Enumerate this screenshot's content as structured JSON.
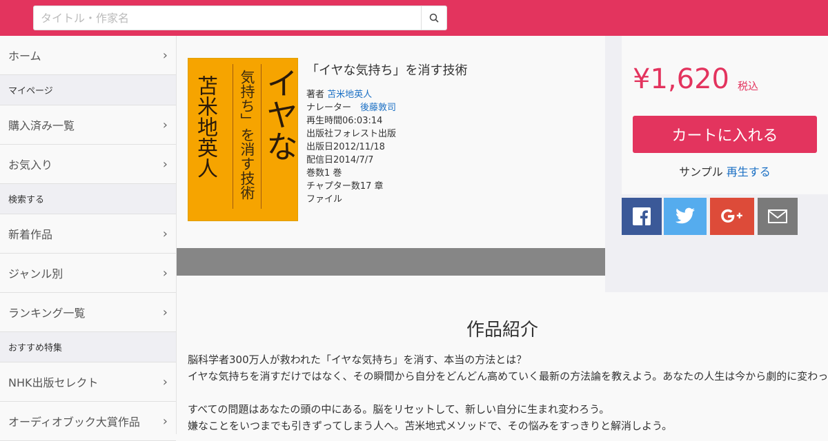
{
  "search": {
    "placeholder": "タイトル・作家名"
  },
  "sidebar": {
    "items": [
      {
        "type": "item",
        "label": "ホーム"
      },
      {
        "type": "head",
        "label": "マイページ"
      },
      {
        "type": "item",
        "label": "購入済み一覧"
      },
      {
        "type": "item",
        "label": "お気入り"
      },
      {
        "type": "head",
        "label": "検索する"
      },
      {
        "type": "item",
        "label": "新着作品"
      },
      {
        "type": "item",
        "label": "ジャンル別"
      },
      {
        "type": "item",
        "label": "ランキング一覧"
      },
      {
        "type": "head",
        "label": "おすすめ特集"
      },
      {
        "type": "item",
        "label": "NHK出版セレクト"
      },
      {
        "type": "item",
        "label": "オーディオブック大賞作品"
      }
    ]
  },
  "book": {
    "cover_title": "イヤな",
    "cover_subtitle": "気持ち」を消す技術",
    "cover_author": "苫米地英人",
    "title": "「イヤな気持ち」を消す技術",
    "author_label": "著者",
    "author": "苫米地英人",
    "narrator_label": "ナレーター",
    "narrator": "後藤敦司",
    "duration": "再生時間06:03:14",
    "publisher": "出版社フォレスト出版",
    "published": "出版日2012/11/18",
    "released": "配信日2014/7/7",
    "volumes": "巻数1 巻",
    "chapters": "チャプター数17 章",
    "format": "ファイル"
  },
  "buy": {
    "price": "¥1,620",
    "tax": "税込",
    "button": "カートに入れる",
    "sample_label": "サンプル",
    "sample_link": "再生する"
  },
  "share": {
    "colors": {
      "facebook": "#3b5998",
      "twitter": "#55acee",
      "google": "#dd4b39",
      "mail": "#7a7a7a"
    }
  },
  "description": {
    "heading": "作品紹介",
    "lines": [
      "脳科学者300万人が救われた「イヤな気持ち」を消す、本当の方法とは？",
      "イヤな気持ちを消すだけではなく、その瞬間から自分をどんどん高めていく最新の方法論を教えよう。あなたの人生は今から劇的に変わっていく。",
      "",
      "すべての問題はあなたの頭の中にある。脳をリセットして、新しい自分に生まれ変わろう。",
      "嫌なことをいつまでも引きずってしまう人へ。苫米地式メソッドで、その悩みをすっきりと解消しよう。"
    ]
  },
  "colors": {
    "brand": "#e3345e",
    "link": "#1a6fc4"
  }
}
